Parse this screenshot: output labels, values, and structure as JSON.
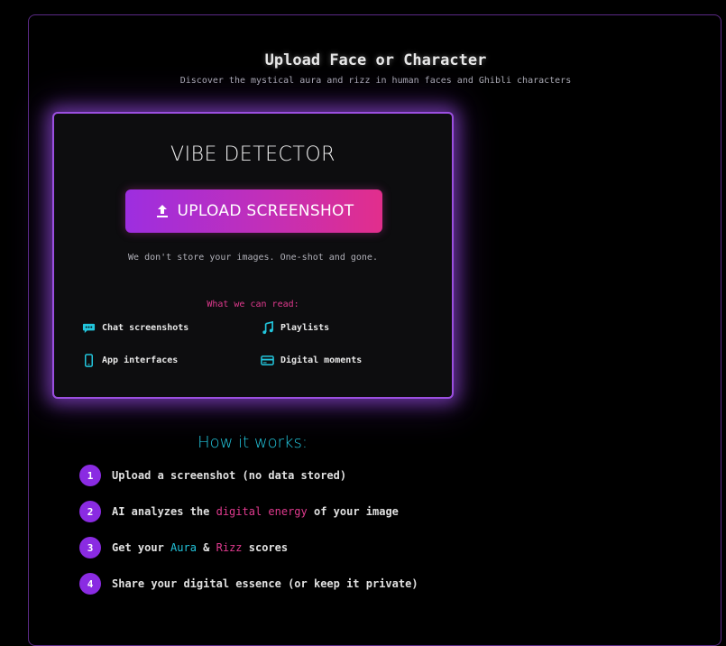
{
  "header": {
    "title": "Upload Face or Character",
    "subtitle": "Discover the mystical aura and rizz in human faces and Ghibli characters"
  },
  "card": {
    "title": "VIBE DETECTOR",
    "upload_label": "UPLOAD SCREENSHOT",
    "privacy_note": "We don't store your images. One-shot and gone.",
    "read_heading": "What we can read:",
    "read_items": [
      {
        "label": "Chat screenshots",
        "icon": "chat-bubble-icon"
      },
      {
        "label": "Playlists",
        "icon": "music-note-icon"
      },
      {
        "label": "App interfaces",
        "icon": "phone-icon"
      },
      {
        "label": "Digital moments",
        "icon": "card-icon"
      }
    ]
  },
  "how": {
    "title": "How it works:",
    "steps": [
      {
        "num": "1",
        "text": "Upload a screenshot (no data stored)"
      },
      {
        "num": "2",
        "pre": "AI analyzes the ",
        "highlight": "digital energy",
        "post": " of your image"
      },
      {
        "num": "3",
        "pre": "Get your ",
        "aura": "Aura",
        "amp": " & ",
        "rizz": "Rizz",
        "post": " scores"
      },
      {
        "num": "4",
        "text": "Share your digital essence (or keep it private)"
      }
    ]
  },
  "colors": {
    "accent_purple": "#9b4fe0",
    "accent_pink": "#e03a8e",
    "accent_cyan": "#22c5dc",
    "background": "#000000"
  }
}
